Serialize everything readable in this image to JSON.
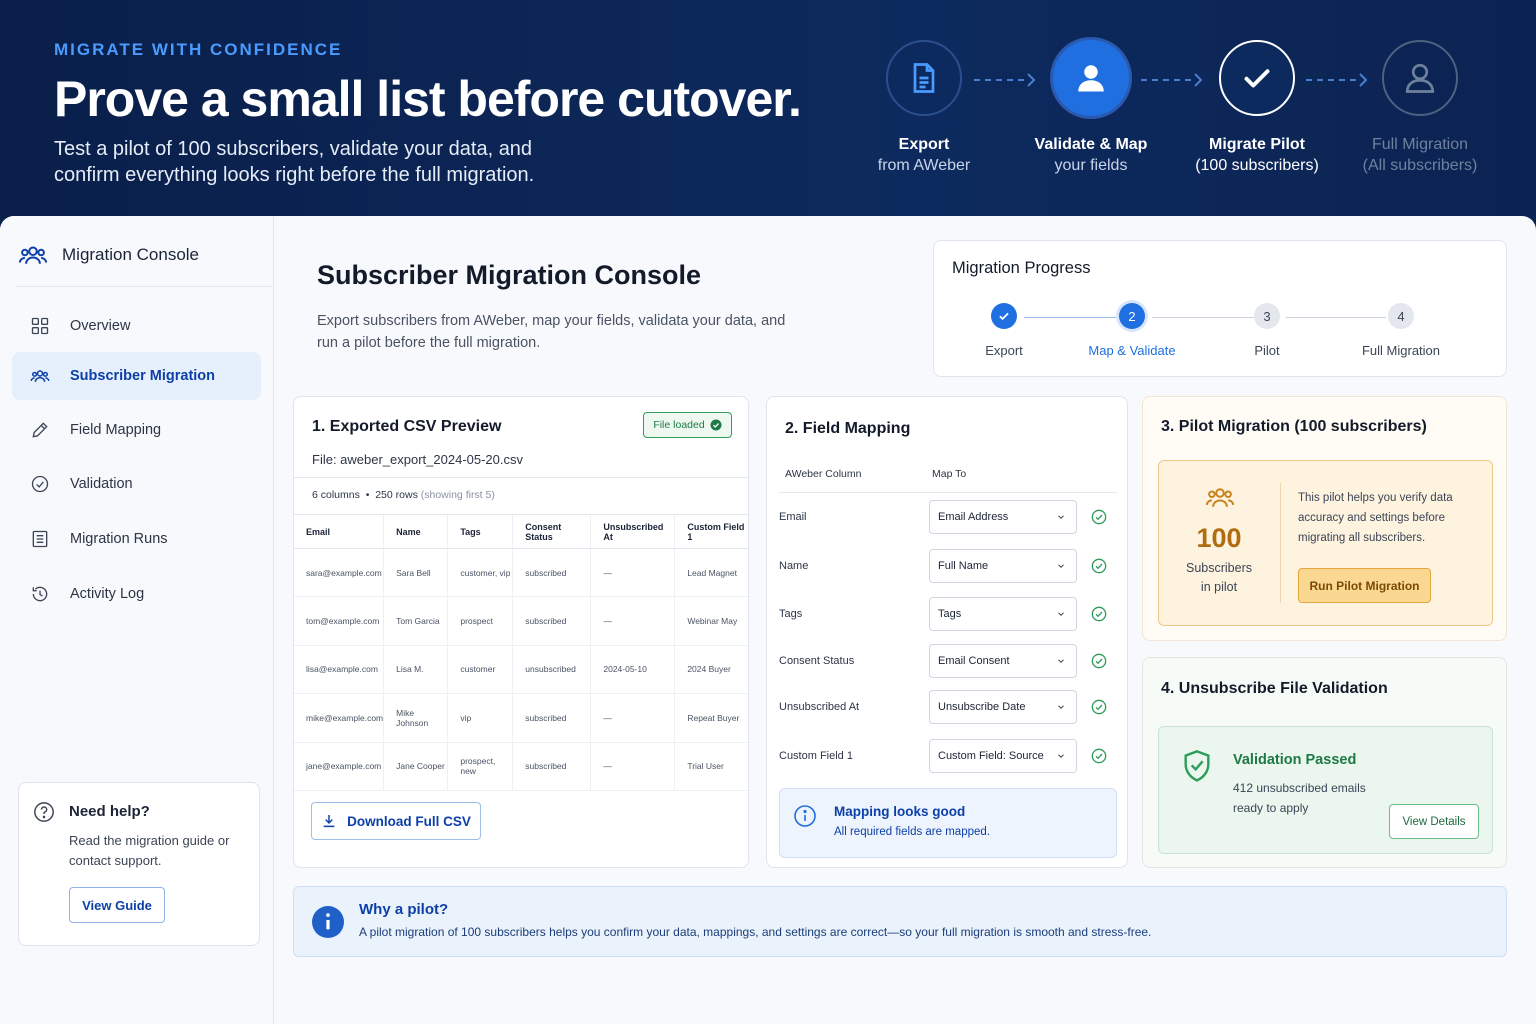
{
  "hero": {
    "eyebrow": "MIGRATE WITH CONFIDENCE",
    "title": "Prove a small list before cutover.",
    "subtitle": "Test a pilot of 100 subscribers, validate your data, and confirm everything looks right before the full migration.",
    "steps": [
      {
        "title": "Export",
        "sub": "from AWeber",
        "icon": "document-icon",
        "state": "outline"
      },
      {
        "title": "Validate & Map",
        "sub": "your fields",
        "icon": "user-icon",
        "state": "active"
      },
      {
        "title": "Migrate Pilot",
        "sub": "(100 subscribers)",
        "icon": "check-icon",
        "state": "outline"
      },
      {
        "title": "Full Migration",
        "sub": "(All subscribers)",
        "icon": "user-icon",
        "state": "disabled"
      }
    ]
  },
  "sidebar": {
    "title": "Migration Console",
    "items": [
      {
        "label": "Overview",
        "icon": "grid-icon"
      },
      {
        "label": "Subscriber Migration",
        "icon": "users-icon",
        "active": true
      },
      {
        "label": "Field Mapping",
        "icon": "pencil-icon"
      },
      {
        "label": "Validation",
        "icon": "check-circle-icon"
      },
      {
        "label": "Migration Runs",
        "icon": "list-icon"
      },
      {
        "label": "Activity Log",
        "icon": "history-icon"
      }
    ],
    "help": {
      "title": "Need help?",
      "text": "Read the migration guide or contact support.",
      "button": "View Guide"
    }
  },
  "main": {
    "title": "Subscriber Migration Console",
    "subtitle": "Export subscribers from AWeber, map your fields, validata your data, and run a pilot before the full migration."
  },
  "progress": {
    "title": "Migration Progress",
    "steps": [
      {
        "num": "",
        "label": "Export",
        "state": "done"
      },
      {
        "num": "2",
        "label": "Map & Validate",
        "state": "current"
      },
      {
        "num": "3",
        "label": "Pilot",
        "state": "pending"
      },
      {
        "num": "4",
        "label": "Full Migration",
        "state": "pending"
      }
    ]
  },
  "csv": {
    "title": "1.  Exported CSV Preview",
    "badge": "File loaded",
    "file": "File: aweber_export_2024-05-20.csv",
    "columns_count": "6 columns",
    "rows_count": "250 rows",
    "rows_note": "(showing first 5)",
    "headers": [
      "Email",
      "Name",
      "Tags",
      "Consent Status",
      "Unsubscribed At",
      "Custom Field 1"
    ],
    "rows": [
      [
        "sara@example.com",
        "Sara Bell",
        "customer, vip",
        "subscribed",
        "—",
        "Lead Magnet"
      ],
      [
        "tom@example.com",
        "Tom Garcia",
        "prospect",
        "subscribed",
        "—",
        "Webinar May"
      ],
      [
        "lisa@example.com",
        "Lisa M.",
        "customer",
        "unsubscribed",
        "2024-05-10",
        "2024 Buyer"
      ],
      [
        "mike@example.com",
        "Mike Johnson",
        "vip",
        "subscribed",
        "—",
        "Repeat Buyer"
      ],
      [
        "jane@example.com",
        "Jane Cooper",
        "prospect, new",
        "subscribed",
        "—",
        "Trial User"
      ]
    ],
    "download": "Download Full CSV"
  },
  "mapping": {
    "title": "2.  Field Mapping",
    "col_a": "AWeber Column",
    "col_b": "Map To",
    "rows": [
      {
        "source": "Email",
        "target": "Email Address"
      },
      {
        "source": "Name",
        "target": "Full Name"
      },
      {
        "source": "Tags",
        "target": "Tags"
      },
      {
        "source": "Consent Status",
        "target": "Email Consent"
      },
      {
        "source": "Unsubscribed At",
        "target": "Unsubscribe Date"
      },
      {
        "source": "Custom Field 1",
        "target": "Custom Field: Source"
      }
    ],
    "note_title": "Mapping looks good",
    "note_text": "All required fields are mapped."
  },
  "pilot": {
    "title": "3.  Pilot Migration (100 subscribers)",
    "count": "100",
    "count_label": "Subscribers in pilot",
    "text": "This pilot helps you verify data accuracy and settings before migrating all subscribers.",
    "button": "Run Pilot Migration"
  },
  "unsub": {
    "title": "4.  Unsubscribe File Validation",
    "status": "Validation Passed",
    "text": "412 unsubscribed emails ready to apply",
    "button": "View Details"
  },
  "why": {
    "title": "Why a pilot?",
    "text": "A pilot migration of 100 subscribers helps you confirm your data, mappings, and settings are correct—so your full migration is smooth and stress-free."
  },
  "colors": {
    "accent": "#1f6fe0",
    "navy": "#0b2350",
    "success": "#2e9d5b",
    "warning": "#e9a332"
  }
}
